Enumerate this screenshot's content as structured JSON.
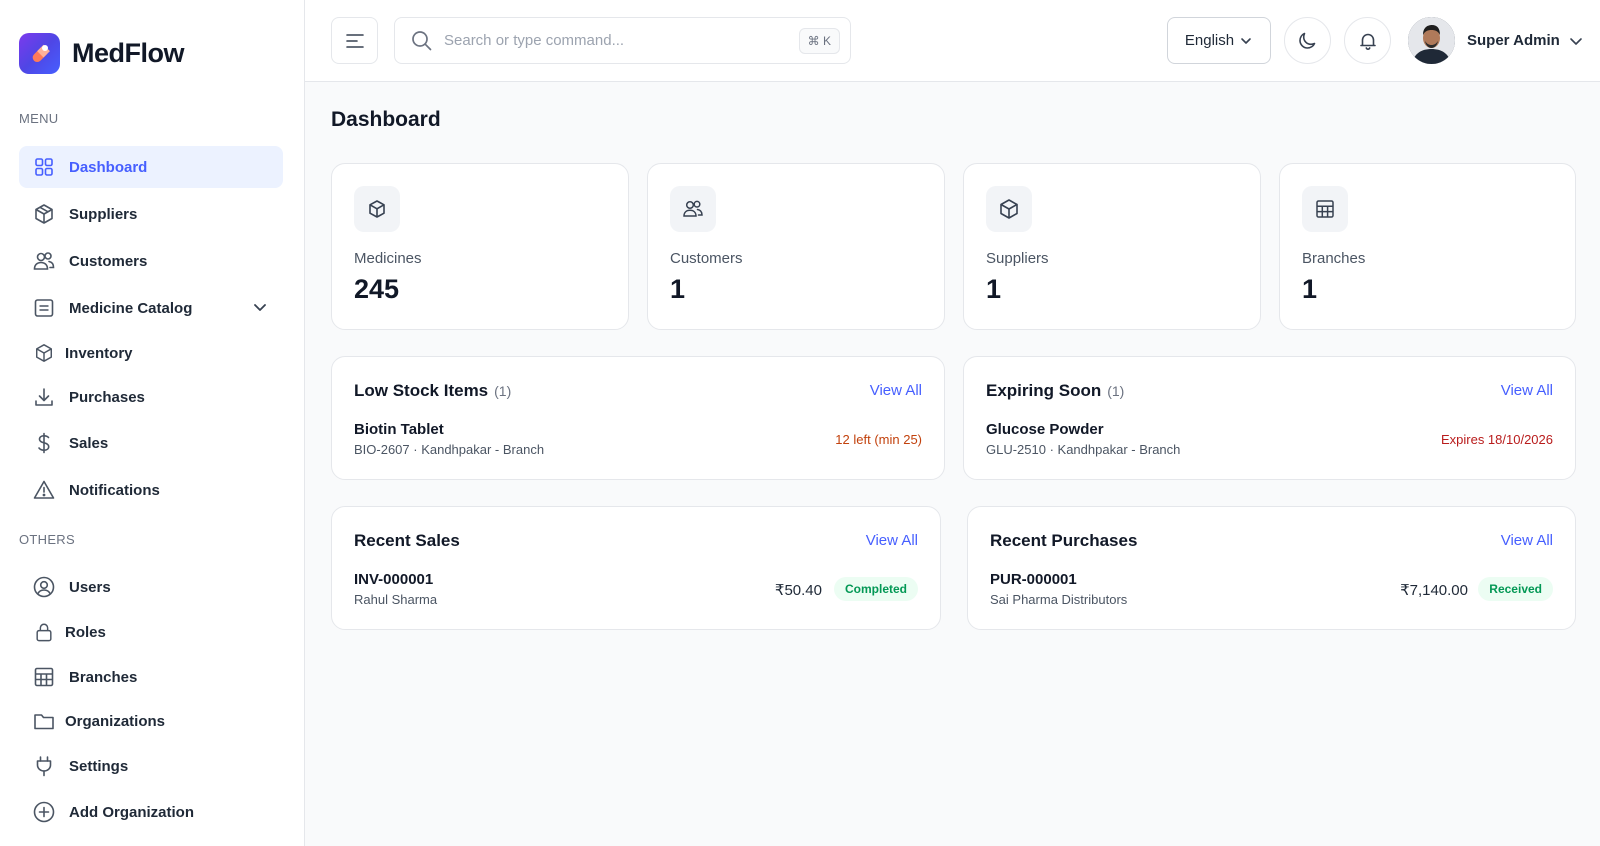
{
  "brand": {
    "name": "MedFlow"
  },
  "sidebar": {
    "menu_label": "MENU",
    "others_label": "OTHERS",
    "menu_items": [
      {
        "label": "Dashboard",
        "icon": "grid-icon"
      },
      {
        "label": "Suppliers",
        "icon": "box-icon"
      },
      {
        "label": "Customers",
        "icon": "users-icon"
      },
      {
        "label": "Medicine Catalog",
        "icon": "list-icon"
      },
      {
        "label": "Inventory",
        "icon": "box-icon"
      },
      {
        "label": "Purchases",
        "icon": "download-icon"
      },
      {
        "label": "Sales",
        "icon": "dollar-icon"
      },
      {
        "label": "Notifications",
        "icon": "alert-icon"
      }
    ],
    "other_items": [
      {
        "label": "Users",
        "icon": "user-circle-icon"
      },
      {
        "label": "Roles",
        "icon": "lock-icon"
      },
      {
        "label": "Branches",
        "icon": "table-icon"
      },
      {
        "label": "Organizations",
        "icon": "folder-icon"
      },
      {
        "label": "Settings",
        "icon": "plug-icon"
      },
      {
        "label": "Add Organization",
        "icon": "plus-circle-icon"
      }
    ]
  },
  "header": {
    "search_placeholder": "Search or type command...",
    "search_shortcut": "⌘ K",
    "language": "English",
    "user_name": "Super Admin"
  },
  "main": {
    "title": "Dashboard",
    "stats": [
      {
        "label": "Medicines",
        "value": "245",
        "icon": "cube-icon"
      },
      {
        "label": "Customers",
        "value": "1",
        "icon": "users-icon"
      },
      {
        "label": "Suppliers",
        "value": "1",
        "icon": "cube-icon"
      },
      {
        "label": "Branches",
        "value": "1",
        "icon": "table-icon"
      }
    ],
    "low_stock": {
      "title": "Low Stock Items",
      "count": "(1)",
      "view_all": "View All",
      "item_name": "Biotin Tablet",
      "item_meta": "BIO-2607 · Kandhpakar - Branch",
      "item_status": "12 left (min 25)"
    },
    "expiring": {
      "title": "Expiring Soon",
      "count": "(1)",
      "view_all": "View All",
      "item_name": "Glucose Powder",
      "item_meta": "GLU-2510 · Kandhpakar - Branch",
      "item_status": "Expires 18/10/2026"
    },
    "recent_sales": {
      "title": "Recent Sales",
      "view_all": "View All",
      "invoice": "INV-000001",
      "customer": "Rahul Sharma",
      "amount": "₹50.40",
      "status": "Completed"
    },
    "recent_purchases": {
      "title": "Recent Purchases",
      "view_all": "View All",
      "invoice": "PUR-000001",
      "supplier": "Sai Pharma Distributors",
      "amount": "₹7,140.00",
      "status": "Received"
    }
  },
  "colors": {
    "accent": "#465fff",
    "active_bg": "#ecf2ff",
    "warning": "#c2410c",
    "error": "#b91c1c",
    "success": "#039855"
  }
}
